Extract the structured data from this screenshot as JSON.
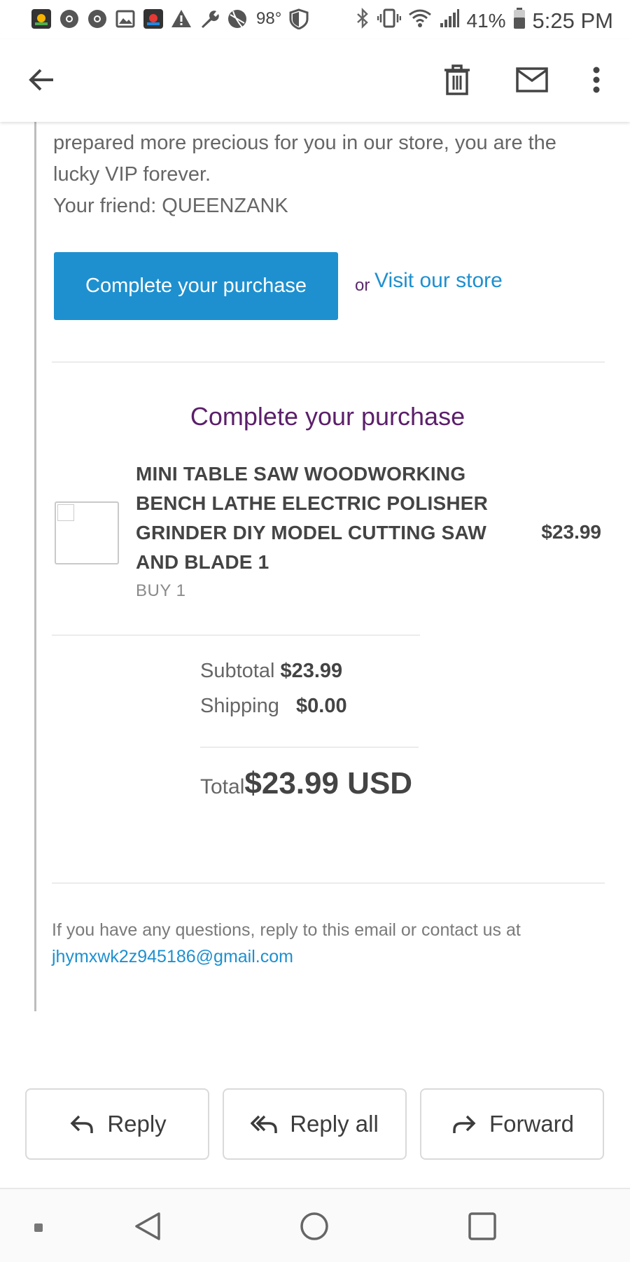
{
  "status_bar": {
    "icons": [
      "nbc-icon",
      "chrome-icon",
      "chrome-icon",
      "image-icon",
      "nbc-icon",
      "warning-icon",
      "wrench-icon",
      "basketball-icon"
    ],
    "temperature": "98°",
    "shield": "shield-icon",
    "right_icons": [
      "bluetooth-icon",
      "vibrate-icon",
      "wifi-icon",
      "signal-icon"
    ],
    "battery_percent": "41%",
    "time": "5:25 PM"
  },
  "app_bar": {
    "back": "arrow-back-icon",
    "actions": [
      "delete-icon",
      "mark-unread-icon",
      "more-vert-icon"
    ]
  },
  "email": {
    "intro_lines": [
      "prepared more precious for you in our store, you are the",
      "lucky VIP forever.",
      "Your friend: QUEENZANK"
    ],
    "cta_label": "Complete your purchase",
    "or_text": "or",
    "visit_label": "Visit our store",
    "section_title": "Complete your purchase",
    "product": {
      "title": "MINI TABLE SAW WOODWORKING BENCH LATHE ELECTRIC POLISHER GRINDER DIY MODEL CUTTING SAW AND BLADE  1",
      "qty": "BUY 1",
      "price": "$23.99"
    },
    "subtotal_label": "Subtotal",
    "subtotal_value": "$23.99",
    "shipping_label": "Shipping",
    "shipping_value": "$0.00",
    "total_label": "Total",
    "total_value": "$23.99 USD",
    "footer_text": "If you have any questions, reply to this email or contact us at",
    "footer_email": "jhymxwk2z945186@gmail.com"
  },
  "actions": {
    "reply": "Reply",
    "reply_all": "Reply all",
    "forward": "Forward"
  },
  "colors": {
    "accent": "#1e90cf",
    "title_purple": "#5b1f6a"
  }
}
